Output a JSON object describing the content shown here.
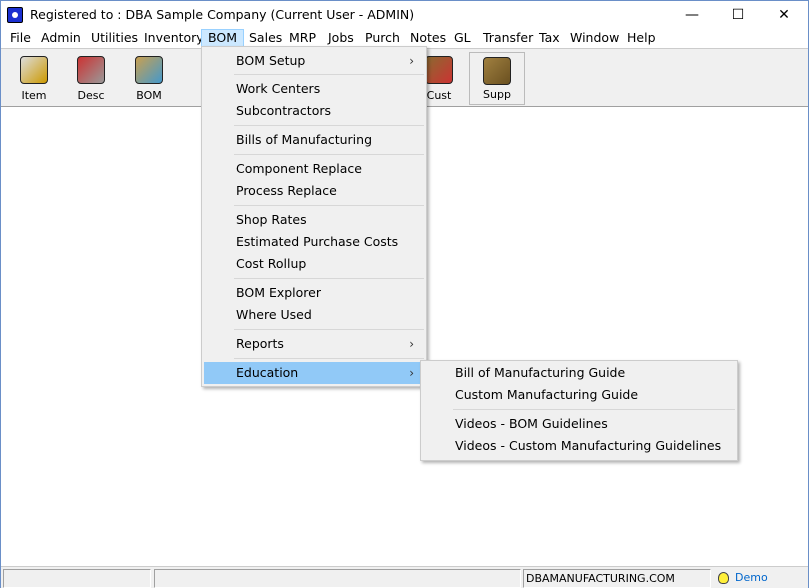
{
  "title": "Registered to : DBA Sample Company (Current User - ADMIN)",
  "window_controls": {
    "minimize": "—",
    "maximize": "☐",
    "close": "✕"
  },
  "menubar": [
    "File",
    "Admin",
    "Utilities",
    "Inventory",
    "BOM",
    "Sales",
    "MRP",
    "Jobs",
    "Purch",
    "Notes",
    "GL",
    "Transfer",
    "Tax",
    "Window",
    "Help"
  ],
  "active_menu": "BOM",
  "toolbar": [
    {
      "label": "Item",
      "icon": "item-box-icon"
    },
    {
      "label": "Desc",
      "icon": "description-icon"
    },
    {
      "label": "BOM",
      "icon": "bom-icon"
    },
    {
      "label": "Cust",
      "icon": "customer-folder-icon"
    },
    {
      "label": "Supp",
      "icon": "supplier-folder-icon"
    }
  ],
  "bom_menu": [
    {
      "label": "BOM Setup",
      "submenu": true
    },
    {
      "label": "Work Centers"
    },
    {
      "label": "Subcontractors"
    },
    {
      "label": "Bills of Manufacturing"
    },
    {
      "label": "Component Replace"
    },
    {
      "label": "Process Replace"
    },
    {
      "label": "Shop Rates"
    },
    {
      "label": "Estimated Purchase Costs"
    },
    {
      "label": "Cost Rollup"
    },
    {
      "label": "BOM Explorer"
    },
    {
      "label": "Where Used"
    },
    {
      "label": "Reports",
      "submenu": true
    },
    {
      "label": "Education",
      "submenu": true,
      "highlighted": true
    }
  ],
  "education_submenu": [
    "Bill of Manufacturing Guide",
    "Custom Manufacturing Guide",
    "Videos - BOM Guidelines",
    "Videos - Custom Manufacturing Guidelines"
  ],
  "status": {
    "website": "DBAMANUFACTURING.COM",
    "mode": "Demo",
    "mode_icon": "lightbulb-icon",
    "mode_color": "#0066cc"
  },
  "colors": {
    "highlight": "#91c9f7",
    "menu_active": "#cce8ff"
  }
}
